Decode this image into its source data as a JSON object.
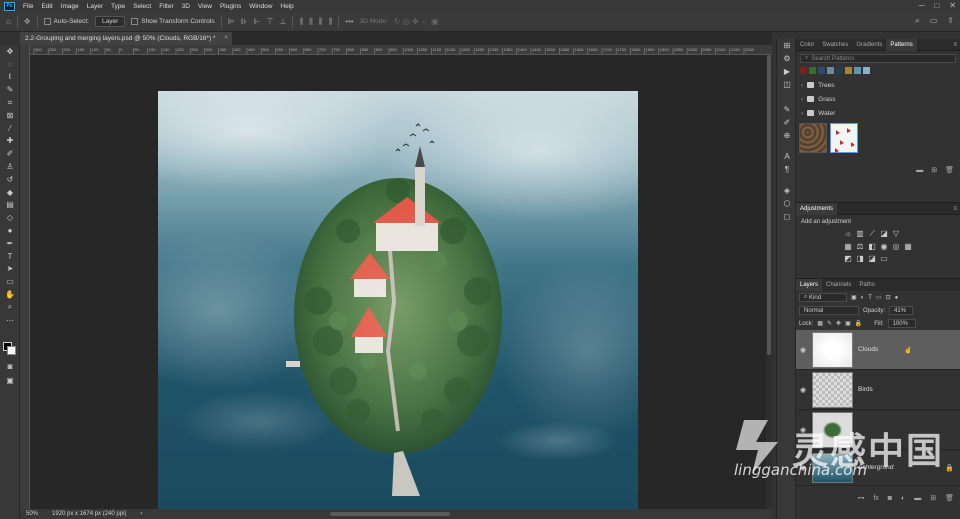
{
  "app": {
    "logo": "Ps"
  },
  "menu": [
    "File",
    "Edit",
    "Image",
    "Layer",
    "Type",
    "Select",
    "Filter",
    "3D",
    "View",
    "Plugins",
    "Window",
    "Help"
  ],
  "options": {
    "auto_select_label": "Auto-Select:",
    "auto_select_value": "Layer",
    "show_transform_label": "Show Transform Controls",
    "mode_3d_label": "3D Mode:"
  },
  "document_tab": {
    "title": "2.2-Grouping and merging layers.psd @ 50% (Clouds, RGB/16*) *",
    "close": "×"
  },
  "ruler_ticks": [
    "300",
    "250",
    "200",
    "150",
    "100",
    "50",
    "0",
    "50",
    "100",
    "150",
    "200",
    "250",
    "300",
    "350",
    "400",
    "450",
    "500",
    "550",
    "600",
    "650",
    "700",
    "750",
    "800",
    "850",
    "900",
    "950",
    "1000",
    "1050",
    "1100",
    "1150",
    "1200",
    "1250",
    "1300",
    "1350",
    "1400",
    "1450",
    "1500",
    "1550",
    "1600",
    "1650",
    "1700",
    "1750",
    "1800",
    "1850",
    "1900",
    "1950",
    "2000",
    "2050",
    "2100",
    "2150",
    "2200"
  ],
  "status": {
    "zoom": "50%",
    "doc_info": "1920 px x 1674 px (240 ppi)"
  },
  "patterns_panel": {
    "tabs": [
      "Color",
      "Swatches",
      "Gradients",
      "Patterns"
    ],
    "active_tab": "Patterns",
    "search_placeholder": "Search Patterns",
    "swatches": [
      "#7a2020",
      "#3a6b2a",
      "#2a4a6e",
      "#6e8a9a",
      "#2a3a4e",
      "#a88040",
      "#5a9ab0",
      "#8ab0c8"
    ],
    "folders": [
      "Trees",
      "Grass",
      "Water"
    ]
  },
  "adjustments_panel": {
    "title": "Adjustments",
    "add_label": "Add an adjustment"
  },
  "layers_panel": {
    "tabs": [
      "Layers",
      "Channels",
      "Paths"
    ],
    "active_tab": "Layers",
    "kind_label": "Kind",
    "blend_mode": "Normal",
    "opacity_label": "Opacity:",
    "opacity_value": "41%",
    "lock_label": "Lock:",
    "fill_label": "Fill:",
    "fill_value": "100%",
    "layers": [
      {
        "name": "Clouds",
        "selected": true
      },
      {
        "name": "Birds",
        "selected": false
      },
      {
        "name": "",
        "selected": false
      },
      {
        "name": "Achtergrond",
        "selected": false
      }
    ]
  },
  "watermark": {
    "chinese": "灵感中国",
    "url": "lingganchina.com"
  }
}
